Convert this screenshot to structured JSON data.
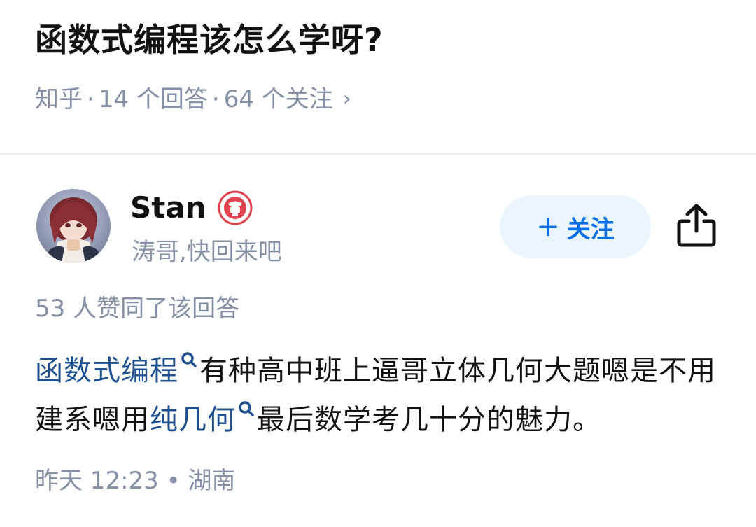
{
  "question": {
    "title": "函数式编程该怎么学呀?",
    "source": "知乎",
    "answers": "14 个回答",
    "followers": "64 个关注",
    "separator": "·",
    "chevron": "›"
  },
  "author": {
    "name": "Stan",
    "bio": "涛哥,快回来吧",
    "follow_label": "关注",
    "follow_plus": "+",
    "avatar_icon": "anime-avatar",
    "badge_icon": "creator-badge-icon",
    "share_icon": "share-icon"
  },
  "answer": {
    "votes": "53 人赞同了该回答",
    "link1": "函数式编程",
    "text1": "有种高中班上逼哥立体几何大题嗯是不用建系嗯用",
    "link2": "纯几何",
    "text2": "最后数学考几十分的魅力。",
    "timestamp": "昨天 12:23 • 湖南"
  },
  "colors": {
    "link": "#1e4f8f",
    "accent": "#056de8",
    "muted": "#8590a6",
    "badge": "#e0454f"
  }
}
